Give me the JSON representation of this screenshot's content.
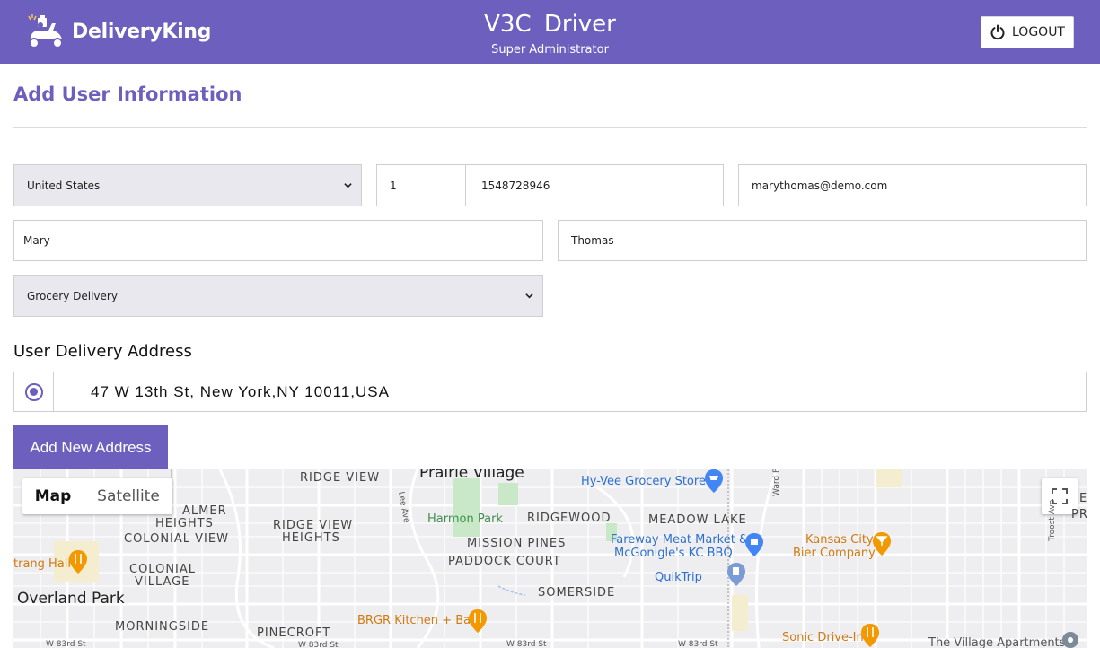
{
  "header": {
    "brand_name": "DeliveryKing",
    "title": "V3C  Driver",
    "subtitle": "Super Administrator",
    "logout_label": "LOGOUT"
  },
  "page": {
    "title": "Add User Information"
  },
  "form": {
    "country": "United States",
    "country_code": "1",
    "phone": "1548728946",
    "email": "marythomas@demo.com",
    "first_name": "Mary",
    "last_name": "Thomas",
    "service_type": "Grocery Delivery"
  },
  "address_section": {
    "title": "User Delivery Address",
    "address": "47 W 13th St, New York,NY 10011,USA",
    "add_button": "Add New Address"
  },
  "map": {
    "tab_map": "Map",
    "tab_satellite": "Satellite",
    "labels": {
      "prairie_village": "Prairie Village",
      "ridge_view": "RIDGE VIEW",
      "ridge_view_heights_1": "RIDGE VIEW",
      "ridge_view_heights_2": "HEIGHTS",
      "palmer_heights_1": "ALMER",
      "palmer_heights_2": "HEIGHTS",
      "colonial_view": "COLONIAL VIEW",
      "colonial_village_1": "COLONIAL",
      "colonial_village_2": "VILLAGE",
      "overland_park": "Overland Park",
      "morningside": "MORNINGSIDE",
      "pinecroft": "PINECROFT",
      "harmon_park": "Harmon Park",
      "ridgewood": "RIDGEWOOD",
      "mission_pines": "MISSION PINES",
      "paddock_court": "PADDOCK COURT",
      "somerside": "SOMERSIDE",
      "meadow_lake": "MEADOW LAKE",
      "hyvee": "Hy-Vee Grocery Store",
      "fareway_1": "Fareway Meat Market &",
      "fareway_2": "McGonigle's KC BBQ",
      "quiktrip": "QuikTrip",
      "kansas_city_1": "Kansas City",
      "kansas_city_2": "Bier Company",
      "brgr": "BRGR Kitchen + Bar",
      "sonic": "Sonic Drive-In",
      "village_apts": "The Village Apartments",
      "trang_hall": "trang Hall",
      "w83_1": "W 83rd St",
      "w83_2": "W 83rd St",
      "w83_3": "W 83rd St",
      "w83_4": "W 83rd St",
      "troost": "Troost Ave",
      "ward_pkwy": "Ward Pkwy",
      "lee_ave": "Lee Ave",
      "pro": "PRO",
      "e_edge": "E"
    }
  }
}
